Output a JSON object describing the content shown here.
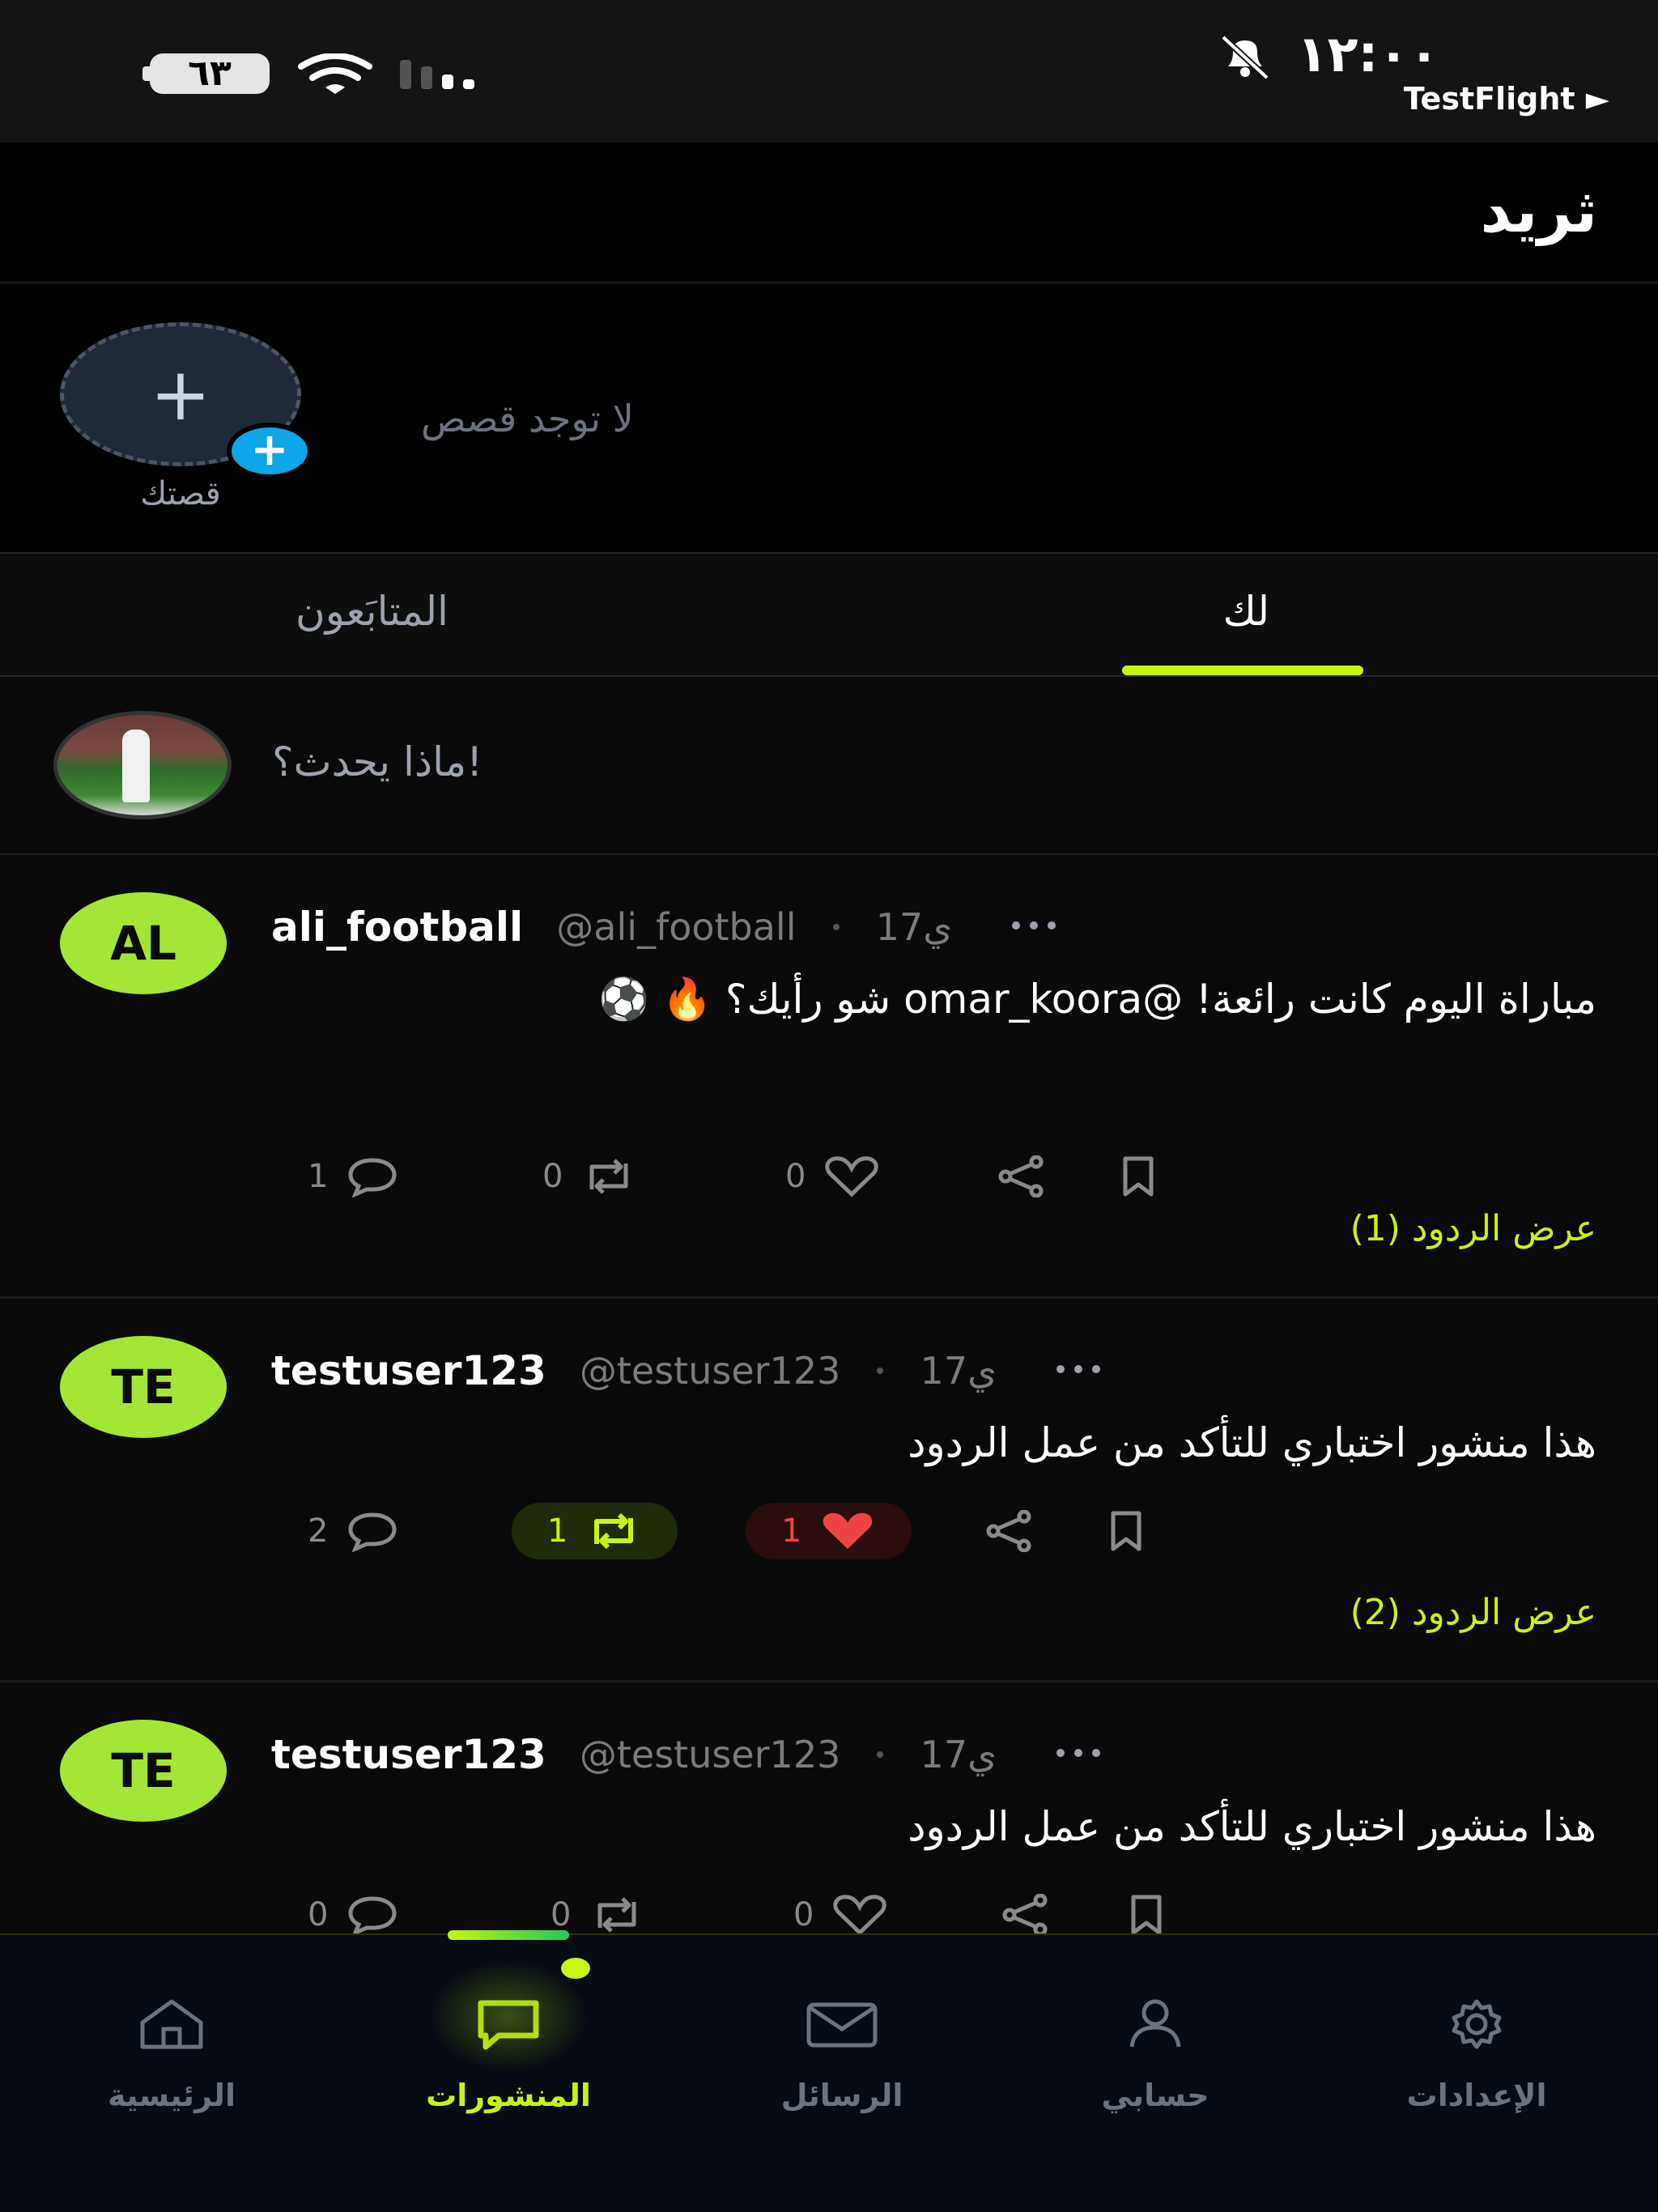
{
  "status_bar": {
    "time": "١٢:٠٠",
    "testflight": "TestFlight ►",
    "battery": "٦٣"
  },
  "header": {
    "title": "ثريد"
  },
  "stories": {
    "add_label": "قصتك",
    "empty_text": "لا توجد قصص"
  },
  "tabs": {
    "for_you": "لك",
    "following": "المتابَعون"
  },
  "composer": {
    "placeholder": "ماذا يحدث؟!"
  },
  "posts": [
    {
      "avatar": "AL",
      "username": "ali_football",
      "handle": "@ali_football",
      "time": "17ي",
      "body": "مباراة اليوم كانت رائعة! @omar_koora شو رأيك؟ 🔥 ⚽",
      "replies": "1",
      "reposts": "0",
      "likes": "0",
      "view_replies": "عرض الردود (1)"
    },
    {
      "avatar": "TE",
      "username": "testuser123",
      "handle": "@testuser123",
      "time": "17ي",
      "body": "هذا منشور اختباري للتأكد من عمل الردود",
      "replies": "2",
      "reposts": "1",
      "likes": "1",
      "view_replies": "عرض الردود (2)"
    },
    {
      "avatar": "TE",
      "username": "testuser123",
      "handle": "@testuser123",
      "time": "17ي",
      "body": "هذا منشور اختباري للتأكد من عمل الردود",
      "replies": "0",
      "reposts": "0",
      "likes": "0"
    }
  ],
  "nav": {
    "home": "الرئيسية",
    "posts": "المنشورات",
    "messages": "الرسائل",
    "account": "حسابي",
    "settings": "الإعدادات"
  },
  "colors": {
    "accent": "#c6f511",
    "avatar_green": "#a3e635",
    "like_red": "#ef4444",
    "story_blue": "#0ea5e9"
  }
}
